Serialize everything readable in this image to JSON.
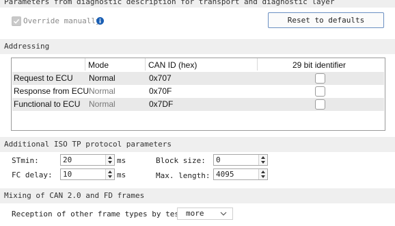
{
  "transport": {
    "header": "Parameters from diagnostic description for transport and diagnostic layer",
    "override_label": "Override manually",
    "override_checked": true,
    "reset_label": "Reset to defaults"
  },
  "addressing": {
    "header": "Addressing",
    "columns": [
      "",
      "Mode",
      "CAN ID (hex)",
      "29 bit identifier"
    ],
    "rows": [
      {
        "name": "Request to ECU",
        "mode": "Normal",
        "can_id": "0x707",
        "bit29": false
      },
      {
        "name": "Response from ECU",
        "mode": "Normal",
        "can_id": "0x70F",
        "bit29": false
      },
      {
        "name": "Functional to ECU",
        "mode": "Normal",
        "can_id": "0x7DF",
        "bit29": false
      }
    ]
  },
  "iso_tp": {
    "header": "Additional ISO TP protocol parameters",
    "stmin_label": "STmin:",
    "stmin_value": "20",
    "stmin_unit": "ms",
    "fc_delay_label": "FC delay:",
    "fc_delay_value": "10",
    "fc_delay_unit": "ms",
    "block_size_label": "Block size:",
    "block_size_value": "0",
    "max_length_label": "Max. length:",
    "max_length_value": "4095"
  },
  "mixing": {
    "header": "Mixing of CAN 2.0 and FD frames",
    "reception_label": "Reception of other frame types by tester:",
    "reception_value": "more"
  },
  "icons": {
    "info": "info-icon",
    "check": "checkmark-icon",
    "spin_up": "arrow-up-icon",
    "spin_down": "arrow-down-icon",
    "dropdown": "chevron-down-icon"
  },
  "colors": {
    "header_bg": "#efefef",
    "info_blue": "#1a5fb4",
    "button_border": "#6a8fc2",
    "row_highlight": "#e9e9e9"
  }
}
